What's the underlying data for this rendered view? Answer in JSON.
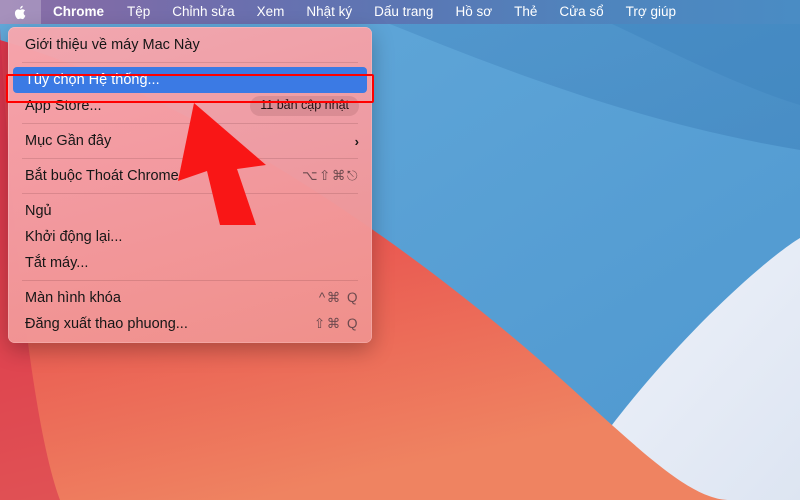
{
  "menubar": {
    "apple_icon": "apple-logo-icon",
    "items": [
      {
        "label": "Chrome",
        "bold": true
      },
      {
        "label": "Tệp",
        "bold": false
      },
      {
        "label": "Chỉnh sửa",
        "bold": false
      },
      {
        "label": "Xem",
        "bold": false
      },
      {
        "label": "Nhật ký",
        "bold": false
      },
      {
        "label": "Dấu trang",
        "bold": false
      },
      {
        "label": "Hồ sơ",
        "bold": false
      },
      {
        "label": "Thẻ",
        "bold": false
      },
      {
        "label": "Cửa sổ",
        "bold": false
      },
      {
        "label": "Trợ giúp",
        "bold": false
      }
    ]
  },
  "apple_menu": {
    "items": [
      {
        "label": "Giới thiệu về máy Mac Này",
        "accessory": "",
        "badge": "",
        "chevron": "",
        "highlighted": false
      },
      {
        "label": "Tùy chọn Hệ thống...",
        "accessory": "",
        "badge": "",
        "chevron": "",
        "highlighted": true
      },
      {
        "label": "App Store...",
        "accessory": "",
        "badge": "11 bản cập nhật",
        "chevron": "",
        "highlighted": false
      },
      {
        "label": "Mục Gần đây",
        "accessory": "",
        "badge": "",
        "chevron": "›",
        "highlighted": false
      },
      {
        "label": "Bắt buộc Thoát Chrome",
        "accessory": "⌥⇧⌘⎋",
        "badge": "",
        "chevron": "",
        "highlighted": false
      },
      {
        "label": "Ngủ",
        "accessory": "",
        "badge": "",
        "chevron": "",
        "highlighted": false
      },
      {
        "label": "Khởi động lại...",
        "accessory": "",
        "badge": "",
        "chevron": "",
        "highlighted": false
      },
      {
        "label": "Tắt máy...",
        "accessory": "",
        "badge": "",
        "chevron": "",
        "highlighted": false
      },
      {
        "label": "Màn hình khóa",
        "accessory": "^⌘ Q",
        "badge": "",
        "chevron": "",
        "highlighted": false
      },
      {
        "label": "Đăng xuất thao phuong...",
        "accessory": "⇧⌘ Q",
        "badge": "",
        "chevron": "",
        "highlighted": false
      }
    ],
    "separators_after": [
      0,
      2,
      3,
      4,
      7
    ]
  },
  "annotations": {
    "highlight_box_color": "#ff0000",
    "arrow_color": "#f91616",
    "arrow_name": "red-pointer-arrow"
  },
  "colors": {
    "menubar_left": "#8b6fa8",
    "menubar_right": "#4a8cc4",
    "selection_blue": "#3b7ae4",
    "wallpaper_red": "#e8504e",
    "wallpaper_blue": "#54a0d4",
    "wallpaper_white": "#e6ecf6"
  }
}
